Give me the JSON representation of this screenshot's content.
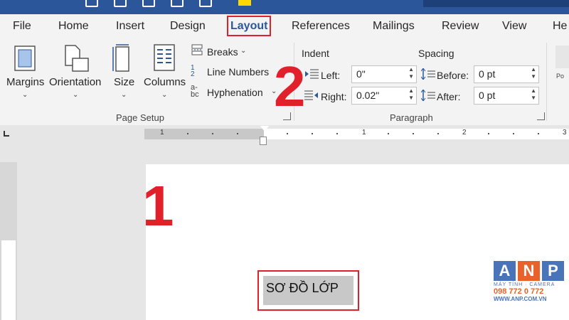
{
  "tabs": [
    {
      "label": "File",
      "active": false
    },
    {
      "label": "Home",
      "active": false
    },
    {
      "label": "Insert",
      "active": false
    },
    {
      "label": "Design",
      "active": false
    },
    {
      "label": "Layout",
      "active": true
    },
    {
      "label": "References",
      "active": false
    },
    {
      "label": "Mailings",
      "active": false
    },
    {
      "label": "Review",
      "active": false
    },
    {
      "label": "View",
      "active": false
    },
    {
      "label": "He",
      "active": false
    }
  ],
  "page_setup": {
    "margins": "Margins",
    "orientation": "Orientation",
    "size": "Size",
    "columns": "Columns",
    "breaks": "Breaks",
    "line_numbers": "Line Numbers",
    "hyphenation": "Hyphenation",
    "group_label": "Page Setup"
  },
  "paragraph": {
    "indent_title": "Indent",
    "spacing_title": "Spacing",
    "left_label": "Left:",
    "left_value": "0\"",
    "right_label": "Right:",
    "right_value": "0.02\"",
    "before_label": "Before:",
    "before_value": "0 pt",
    "after_label": "After:",
    "after_value": "0 pt",
    "group_label": "Paragraph",
    "clipped_label": "Po"
  },
  "ruler": {
    "numbers": [
      "1",
      "1",
      "1",
      "2",
      "3"
    ]
  },
  "document": {
    "text": "SƠ ĐỒ LỚP"
  },
  "annotations": {
    "step1": "1",
    "step2": "2"
  },
  "watermark": {
    "letters": [
      "A",
      "N",
      "P"
    ],
    "line1": "MÁY TÍNH · CAMERA",
    "line2": "098 772 0 772",
    "line3": "WWW.ANP.COM.VN"
  },
  "colors": {
    "title_bar": "#2b579a",
    "annotation_red": "#e0202a",
    "logo_blue": "#4a74b9",
    "logo_orange": "#e8632c"
  }
}
